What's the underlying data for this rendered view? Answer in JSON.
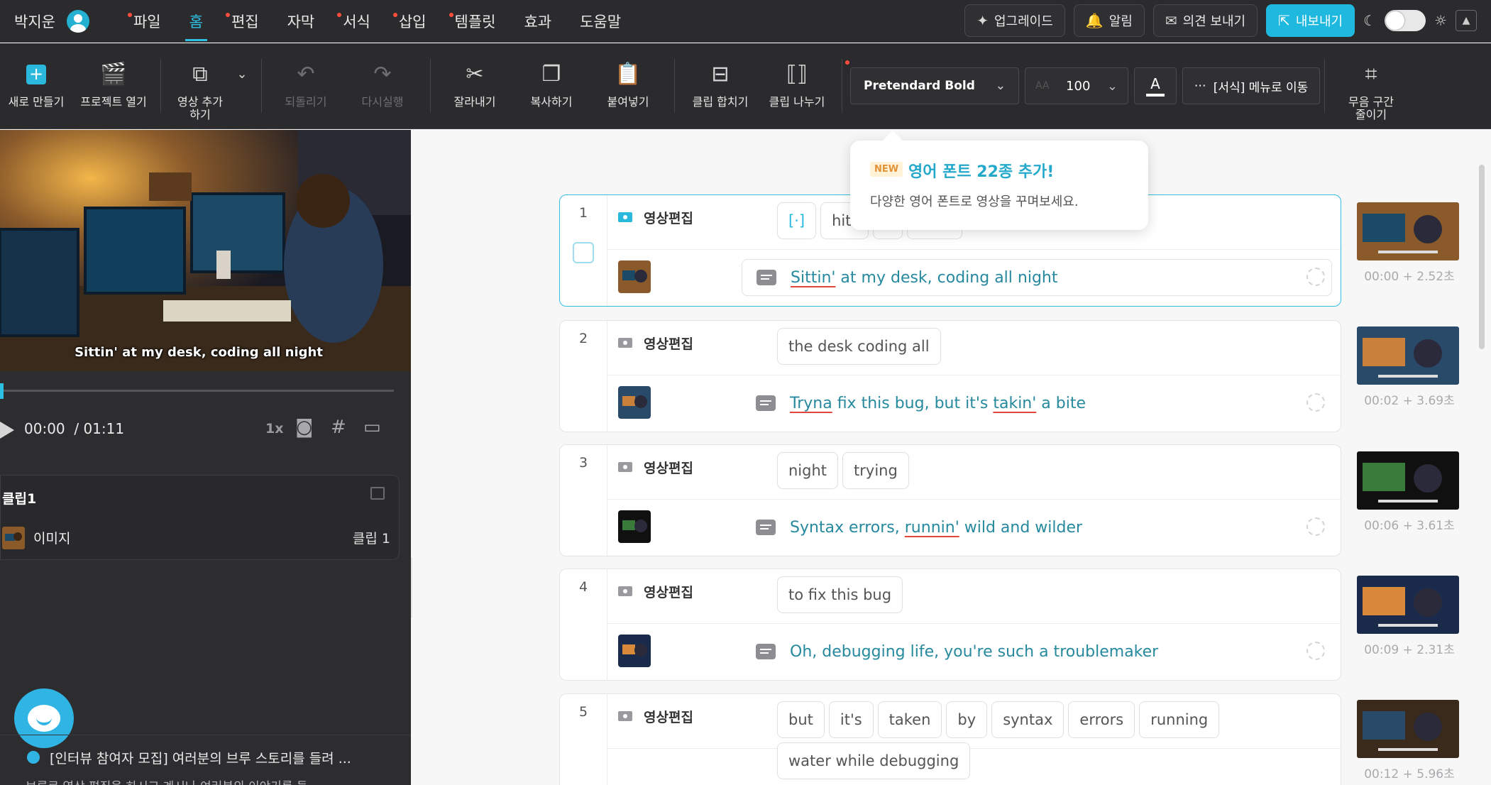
{
  "user": {
    "name": "박지운"
  },
  "menu": [
    {
      "label": "파일",
      "dot": true
    },
    {
      "label": "홈",
      "active": true
    },
    {
      "label": "편집",
      "dot": true
    },
    {
      "label": "자막"
    },
    {
      "label": "서식",
      "dot": true
    },
    {
      "label": "삽입",
      "dot": true
    },
    {
      "label": "템플릿",
      "dot": true
    },
    {
      "label": "효과"
    },
    {
      "label": "도움말"
    }
  ],
  "top_buttons": {
    "upgrade": "업그레이드",
    "notify": "알림",
    "feedback": "의견 보내기",
    "export": "내보내기"
  },
  "toolbar": {
    "new": "새로 만들기",
    "open": "프로젝트 열기",
    "add_video": "영상 추가하기",
    "undo": "되돌리기",
    "redo": "다시실행",
    "cut": "잘라내기",
    "copy": "복사하기",
    "paste": "붙여넣기",
    "merge": "클립 합치기",
    "split": "클립 나누기",
    "font": "Pretendard Bold",
    "size": "100",
    "color_letter": "A",
    "format_move": "[서식] 메뉴로 이동",
    "silence": "무음 구간 줄이기"
  },
  "preview": {
    "subtitle": "Sittin' at my desk, coding all night",
    "time": "00:00",
    "duration": "/ 01:11",
    "speed": "1x"
  },
  "clip_panel": {
    "title": "클립1",
    "row_label": "이미지",
    "row_right": "클립 1"
  },
  "notice": {
    "title": "[인터뷰 참여자 모집] 여러분의 브루 스토리를 들려 ...",
    "subtitle": "브루로 영상 편집을 하시고 계시나 여러분의 이야기를 들"
  },
  "tooltip": {
    "badge": "NEW",
    "title": "영어 폰트 22종 추가!",
    "desc": "다양한 영어 폰트로 영상을 꾸며보세요."
  },
  "clips": [
    {
      "num": "1",
      "category": "영상편집",
      "chips": [
        "[·]",
        "hitt",
        "",
        ""
      ],
      "subtitle_parts": [
        {
          "t": "Sittin'",
          "u": true
        },
        {
          "t": " at my desk, coding all night"
        }
      ],
      "side_time": "00:00 + 2.52초"
    },
    {
      "num": "2",
      "category": "영상편집",
      "chips": [
        "the desk coding all"
      ],
      "subtitle_parts": [
        {
          "t": "Tryna",
          "u": true
        },
        {
          "t": " fix this bug, but it's "
        },
        {
          "t": "takin'",
          "u": true
        },
        {
          "t": " a bite"
        }
      ],
      "side_time": "00:02 + 3.69초"
    },
    {
      "num": "3",
      "category": "영상편집",
      "chips": [
        "night",
        "trying"
      ],
      "subtitle_parts": [
        {
          "t": "Syntax errors, "
        },
        {
          "t": "runnin'",
          "u": true
        },
        {
          "t": " wild and wilder"
        }
      ],
      "side_time": "00:06 + 3.61초"
    },
    {
      "num": "4",
      "category": "영상편집",
      "chips": [
        "to fix this bug"
      ],
      "subtitle_parts": [
        {
          "t": "Oh, debugging life, you're such a troublemaker"
        }
      ],
      "side_time": "00:09 + 2.31초"
    },
    {
      "num": "5",
      "category": "영상편집",
      "chips": [
        "but",
        "it's",
        "taken",
        "by",
        "syntax",
        "errors",
        "running",
        "water while debugging"
      ],
      "subtitle_parts": [],
      "side_time": "00:12 + 5.96초"
    }
  ],
  "colors": {
    "accent": "#2ec0e4",
    "panel": "#2b2b2d",
    "subtitle_text": "#26899e",
    "dot": "#ff4d3d"
  }
}
